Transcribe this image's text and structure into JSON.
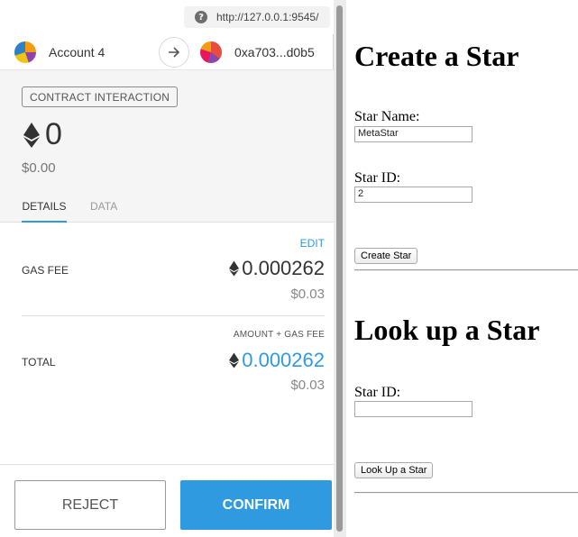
{
  "browser": {
    "url": "http://127.0.0.1:9545/"
  },
  "wallet": {
    "from_account": "Account 4",
    "to_address": "0xa703...d0b5",
    "tx_type": "CONTRACT INTERACTION",
    "amount_eth": "0",
    "amount_fiat": "$0.00",
    "tabs": [
      "DETAILS",
      "DATA"
    ],
    "edit_label": "EDIT",
    "gas_fee_label": "GAS FEE",
    "gas_fee_eth": "0.000262",
    "gas_fee_fiat": "$0.03",
    "total_sublabel": "AMOUNT + GAS FEE",
    "total_label": "TOTAL",
    "total_eth": "0.000262",
    "total_fiat": "$0.03",
    "reject_label": "REJECT",
    "confirm_label": "CONFIRM",
    "accent_color": "#2f9ae0"
  },
  "dapp": {
    "create_title": "Create a Star",
    "star_name_label": "Star Name:",
    "star_name_value": "MetaStar",
    "star_id_label": "Star ID:",
    "star_id_value": "2",
    "create_button": "Create Star",
    "lookup_title": "Look up a Star",
    "lookup_id_label": "Star ID:",
    "lookup_id_value": "",
    "lookup_button": "Look Up a Star"
  }
}
